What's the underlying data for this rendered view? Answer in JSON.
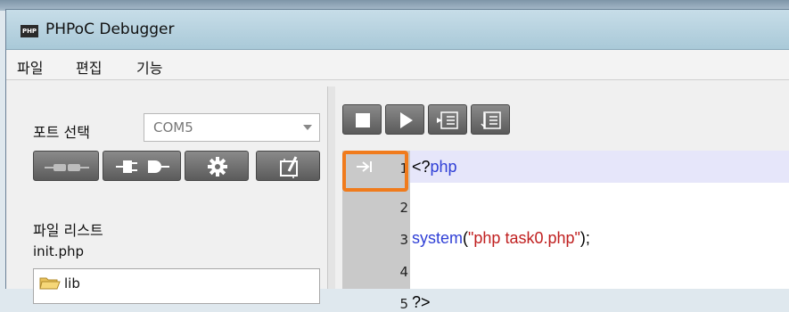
{
  "window": {
    "title": "PHPoC Debugger",
    "app_icon_text": "PHP"
  },
  "menu": [
    "파일",
    "편집",
    "기능"
  ],
  "port": {
    "label": "포트 선택",
    "value": "COM5"
  },
  "left_toolbar": [
    "disconnect-icon",
    "connect-icon",
    "gear-icon",
    "upload-icon"
  ],
  "file_list": {
    "label": "파일 리스트",
    "items": [
      "init.php"
    ],
    "tree": [
      {
        "label": "lib"
      }
    ]
  },
  "debug_toolbar": [
    "stop-icon",
    "play-icon",
    "step-into-icon",
    "step-out-icon"
  ],
  "editor": {
    "lines": [
      {
        "num": "1",
        "tokens": [
          {
            "text": "<?",
            "color": "#000000"
          },
          {
            "text": "php",
            "color": "#2f3fd6"
          }
        ]
      },
      {
        "num": "2",
        "tokens": []
      },
      {
        "num": "3",
        "tokens": [
          {
            "text": "system",
            "color": "#2f3fd6"
          },
          {
            "text": "(",
            "color": "#000000"
          },
          {
            "text": "\"php task0.php\"",
            "color": "#c02020"
          },
          {
            "text": ");",
            "color": "#000000"
          }
        ]
      },
      {
        "num": "4",
        "tokens": []
      },
      {
        "num": "5",
        "tokens": [
          {
            "text": "?>",
            "color": "#000000"
          }
        ]
      }
    ],
    "current_line": "1",
    "highlight_color": "#f07b1c"
  }
}
